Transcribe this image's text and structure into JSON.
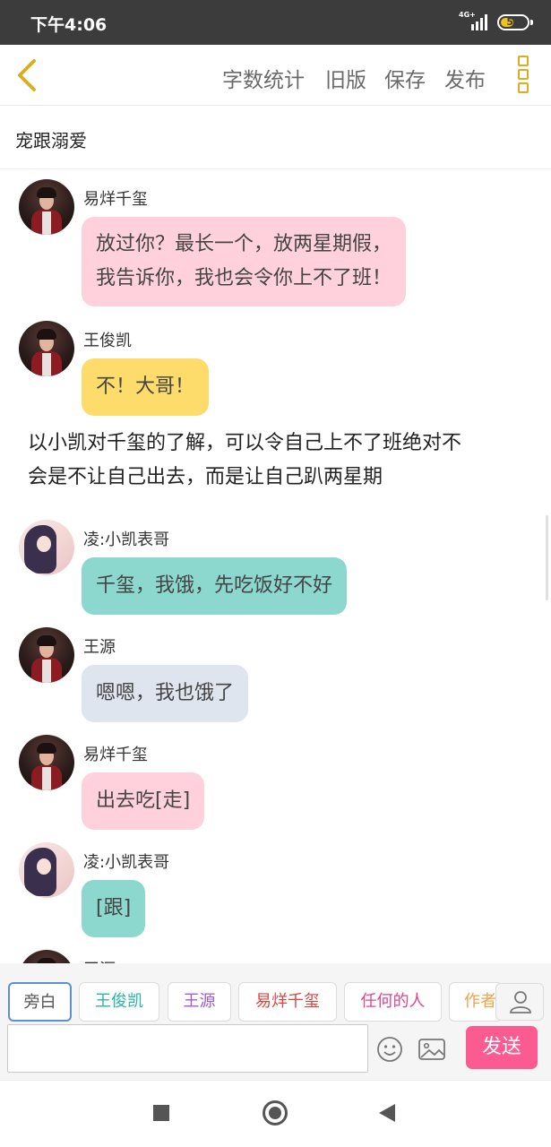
{
  "status_bar": {
    "time": "下午4:06",
    "network": "4G+",
    "battery": "56",
    "battery_level": 0.56
  },
  "toolbar": {
    "word_count": "字数统计",
    "old_version": "旧版",
    "save": "保存",
    "publish": "发布"
  },
  "story": {
    "title": "宠跟溺爱"
  },
  "messages": [
    {
      "speaker": "易烊千玺",
      "lines": [
        "放过你？最长一个，放两星期假，",
        "我告诉你，我也会令你上不了班！"
      ],
      "color": "#ffd1dc"
    },
    {
      "speaker": "王俊凯",
      "lines": [
        "不！大哥！"
      ],
      "color": "#fddc6b"
    },
    {
      "narration": [
        "以小凯对千玺的了解，可以令自己上不了班绝对不",
        "会是不让自己出去，而是让自己趴两星期"
      ]
    },
    {
      "speaker": "凌:小凯表哥",
      "lines": [
        "千玺，我饿，先吃饭好不好"
      ],
      "color": "#8cd7ce"
    },
    {
      "speaker": "王源",
      "lines": [
        "嗯嗯，我也饿了"
      ],
      "color": "#dfe5ee"
    },
    {
      "speaker": "易烊千玺",
      "lines": [
        "出去吃[走]"
      ],
      "color": "#ffd1dc"
    },
    {
      "speaker": "凌:小凯表哥",
      "lines": [
        "[跟]"
      ],
      "color": "#8cd7ce"
    },
    {
      "speaker": "王源",
      "lines": []
    }
  ],
  "characters": [
    {
      "label": "旁白",
      "color": "#555555"
    },
    {
      "label": "王俊凯",
      "color": "#2bb3a7"
    },
    {
      "label": "王源",
      "color": "#a35bd0"
    },
    {
      "label": "易烊千玺",
      "color": "#d9453f"
    },
    {
      "label": "任何的人",
      "color": "#e0468e"
    },
    {
      "label": "作者",
      "color": "#f0a24a"
    }
  ],
  "input": {
    "value": "",
    "placeholder": ""
  },
  "send_label": "发送"
}
